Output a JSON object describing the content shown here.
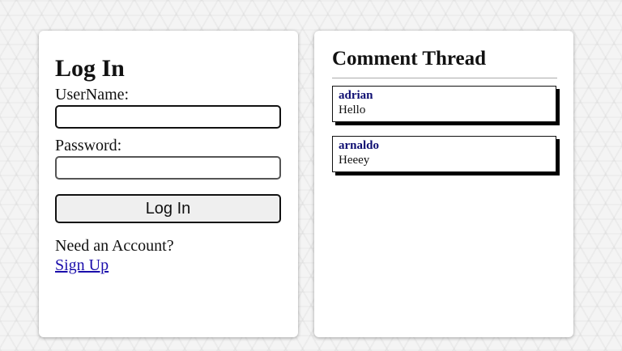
{
  "login": {
    "title": "Log In",
    "username_label": "UserName:",
    "username_value": "",
    "password_label": "Password:",
    "password_value": "",
    "submit_label": "Log In",
    "signup_prompt": "Need an Account?",
    "signup_link": "Sign Up"
  },
  "thread": {
    "title": "Comment Thread",
    "comments": [
      {
        "author": "adrian",
        "text": "Hello"
      },
      {
        "author": "arnaldo",
        "text": "Heeey"
      }
    ]
  },
  "colors": {
    "link": "#1a0dab",
    "author": "#0e0e72",
    "background": "#f4f4f4"
  }
}
